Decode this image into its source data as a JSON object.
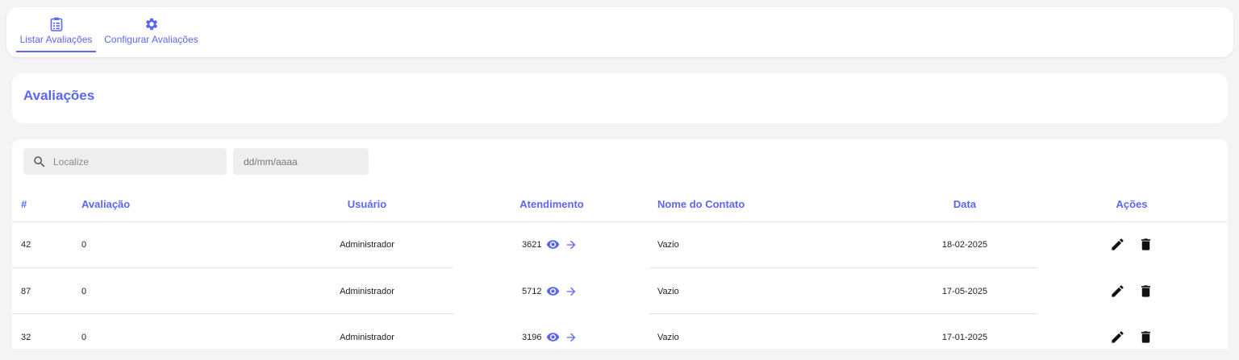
{
  "tabs": [
    {
      "label": "Listar Avaliações",
      "icon": "clipboard-list-icon",
      "active": true
    },
    {
      "label": "Configurar Avaliações",
      "icon": "gear-icon",
      "active": false
    }
  ],
  "page": {
    "title": "Avaliações"
  },
  "filters": {
    "search_placeholder": "Localize",
    "date_placeholder": "dd/mm/aaaa"
  },
  "table": {
    "headers": [
      "#",
      "Avaliação",
      "Usuário",
      "Atendimento",
      "Nome do Contato",
      "Data",
      "Ações"
    ],
    "rows": [
      {
        "id": "42",
        "rating": "0",
        "user": "Administrador",
        "ticket": "3621",
        "contact": "Vazio",
        "date": "18-02-2025"
      },
      {
        "id": "87",
        "rating": "0",
        "user": "Administrador",
        "ticket": "5712",
        "contact": "Vazio",
        "date": "17-05-2025"
      },
      {
        "id": "32",
        "rating": "0",
        "user": "Administrador",
        "ticket": "3196",
        "contact": "Vazio",
        "date": "17-01-2025"
      }
    ]
  },
  "colors": {
    "accent": "#5b67f4",
    "background": "#f4f4f6"
  }
}
